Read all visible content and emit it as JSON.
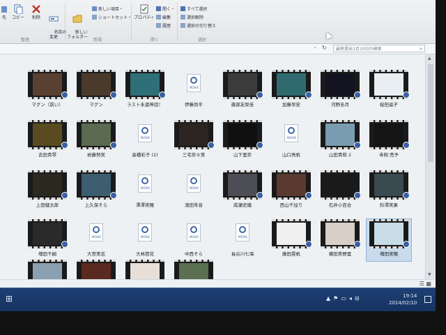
{
  "ribbon": {
    "left_buttons": [
      {
        "label": "先",
        "icon": "pin-icon"
      },
      {
        "label": "コピー",
        "icon": "copy-icon"
      },
      {
        "label": "削除",
        "icon": "delete-icon"
      },
      {
        "label": "名前の\n変更",
        "icon": "rename-icon"
      },
      {
        "label": "新しい\nフォルダー",
        "icon": "new-folder-icon"
      },
      {
        "label": "プロパティ",
        "icon": "properties-icon"
      }
    ],
    "small_items": {
      "new_item": "新しい項目・",
      "shortcut": "ショートカット・",
      "open": "開く・",
      "edit": "編集",
      "history": "履歴",
      "select_all": "すべて選択",
      "select_none": "選択解除",
      "invert_selection": "選択の切り替え"
    },
    "groups": [
      "整理",
      "新規",
      "開く",
      "選択"
    ]
  },
  "navbar": {
    "search_placeholder": "最終提出3月10日の検索"
  },
  "files": [
    {
      "name": "マグン（前い）",
      "type": "video",
      "tint": "#5a4030"
    },
    {
      "name": "マグン",
      "type": "video",
      "tint": "#4a3a2c"
    },
    {
      "name": "ラスト永遠神話！",
      "type": "video",
      "tint": "#2f6f78"
    },
    {
      "name": "伊藤尚平",
      "type": "movie"
    },
    {
      "name": "篠部友梨佳",
      "type": "video",
      "tint": "#3b3b3b"
    },
    {
      "name": "加藤早安",
      "type": "video",
      "tint": "#2f6b6e"
    },
    {
      "name": "河野あ月",
      "type": "video",
      "tint": "#121220"
    },
    {
      "name": "桜田遥子",
      "type": "video",
      "tint": "#e8eef2"
    },
    {
      "name": "吉田貴琴",
      "type": "video",
      "tint": "#5a4a20"
    },
    {
      "name": "岩藤努実",
      "type": "video",
      "tint": "#5b6a50"
    },
    {
      "name": "高橋彩子 (2)",
      "type": "movie"
    },
    {
      "name": "三宅奈々美",
      "type": "video",
      "tint": "#2c2420"
    },
    {
      "name": "山下里奈",
      "type": "video",
      "tint": "#101010"
    },
    {
      "name": "山口亮帆",
      "type": "movie"
    },
    {
      "name": "山田貴和 2",
      "type": "video",
      "tint": "#7a9cb0"
    },
    {
      "name": "寺岡 売予",
      "type": "video",
      "tint": "#141414"
    },
    {
      "name": "上田健太郎",
      "type": "video",
      "tint": "#2a2a20"
    },
    {
      "name": "上久保そら",
      "type": "video",
      "tint": "#3d5d70"
    },
    {
      "name": "澤澤実穂",
      "type": "movie"
    },
    {
      "name": "濱田朱音",
      "type": "movie"
    },
    {
      "name": "成瀬史織",
      "type": "video",
      "tint": "#4d4d55"
    },
    {
      "name": "西山千加り",
      "type": "video",
      "tint": "#5a3a30"
    },
    {
      "name": "石井小百合",
      "type": "video",
      "tint": "#1a1a1a"
    },
    {
      "name": "鈴澤実果",
      "type": "video",
      "tint": "#3a4a50"
    },
    {
      "name": "増田千嗣",
      "type": "video",
      "tint": "#2a2a2a"
    },
    {
      "name": "大宮美志",
      "type": "movie"
    },
    {
      "name": "大林芭花",
      "type": "movie"
    },
    {
      "name": "中西そら",
      "type": "movie"
    },
    {
      "name": "長谷川七海",
      "type": "movie"
    },
    {
      "name": "藤田晃帆",
      "type": "video",
      "tint": "#f0f0f0"
    },
    {
      "name": "横田美野里",
      "type": "video",
      "tint": "#d8d0c8"
    },
    {
      "name": "増田実穂",
      "type": "video",
      "tint": "#c8dce8",
      "selected": true
    },
    {
      "name": "",
      "type": "video",
      "tint": "#8aa0b0"
    },
    {
      "name": "",
      "type": "video",
      "tint": "#5a2a20"
    },
    {
      "name": "",
      "type": "video",
      "tint": "#e8e0d8"
    },
    {
      "name": "",
      "type": "video",
      "tint": "#5a7050"
    }
  ],
  "movie_caption": "MOVIE",
  "taskbar": {
    "time": "19:14",
    "date": "2014/02/10"
  }
}
